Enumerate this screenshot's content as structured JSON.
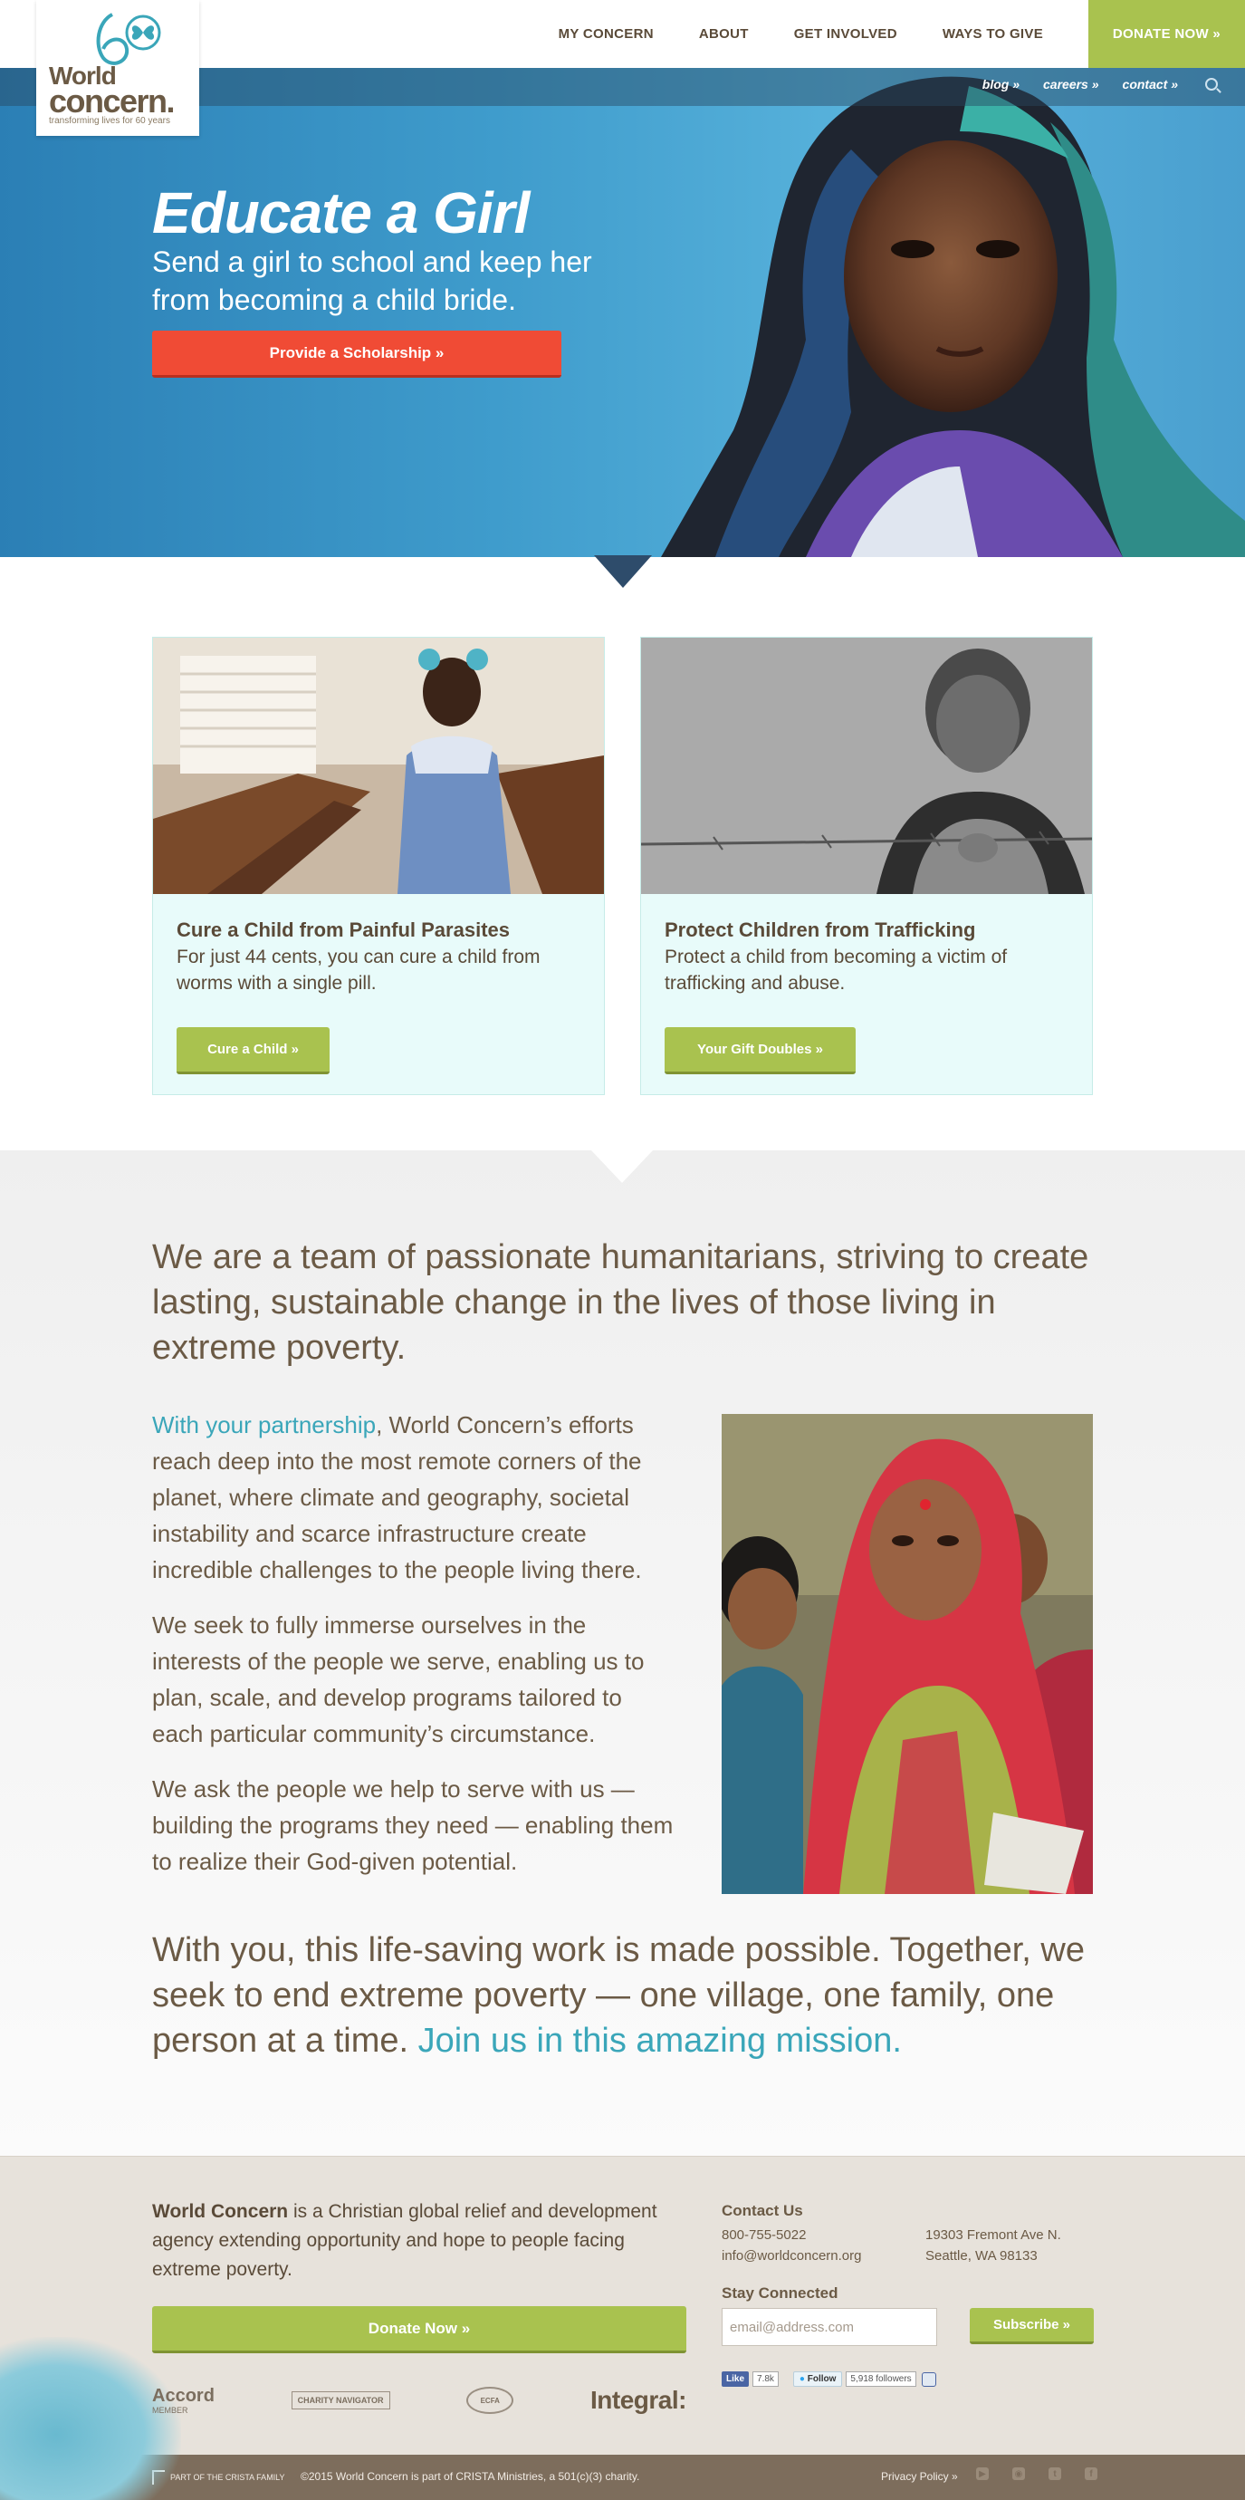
{
  "logo": {
    "line1": "World",
    "line2": "concern.",
    "tagline": "transforming lives for 60 years"
  },
  "nav": {
    "items": [
      "MY CONCERN",
      "ABOUT",
      "GET INVOLVED",
      "WAYS TO GIVE"
    ],
    "donate": "DONATE NOW »"
  },
  "subnav": {
    "items": [
      "blog »",
      "careers »",
      "contact »"
    ]
  },
  "hero": {
    "title": "Educate a Girl",
    "subtitle": "Send a girl to school and keep her from becoming a child bride.",
    "cta": "Provide a Scholarship »"
  },
  "cards": [
    {
      "title": "Cure a Child from Painful Parasites",
      "text": "For just 44 cents, you can cure a child from worms with a single pill.",
      "button": "Cure a Child »"
    },
    {
      "title": "Protect Children from Trafficking",
      "text": "Protect a child from becoming a victim of trafficking and abuse.",
      "button": "Your Gift Doubles »"
    }
  ],
  "about": {
    "lead": "We are a team of passionate humanitarians, striving to create lasting, sustainable change in the lives of those living in extreme poverty.",
    "p1_link": "With your partnership",
    "p1_rest": ", World Concern’s efforts reach deep into the most remote corners of the planet, where climate and geography, societal instability and scarce infrastructure create incredible challenges to the people living there.",
    "p2": "We seek to fully immerse ourselves in the interests of the people we serve, enabling us to plan, scale, and develop programs tailored to each particular community’s circumstance.",
    "p3": "We ask the people we help to serve with us — building the programs they need — enabling them to realize their God-given potential.",
    "closing": "With you, this life-saving work is made possible. Together, we seek to end extreme poverty — one village, one family, one person at a time. ",
    "closing_link": "Join us in this amazing mission."
  },
  "footer": {
    "org_name": "World Concern",
    "org_desc": " is a Christian global relief and development agency extending opportunity and hope to people facing extreme poverty.",
    "donate": "Donate Now »",
    "badges": {
      "accord": "Accord",
      "accord_sub": "MEMBER",
      "charity": "CHARITY NAVIGATOR",
      "ecfa": "ECFA",
      "integral": "Integral:"
    },
    "contact_heading": "Contact Us",
    "phone": "800-755-5022",
    "email_link": "info@worldconcern.org",
    "address1": "19303 Fremont Ave N.",
    "address2": "Seattle, WA 98133",
    "stay_heading": "Stay Connected",
    "email_placeholder": "email@address.com",
    "subscribe": "Subscribe »",
    "fb_like": "Like",
    "fb_count": "7.8k",
    "tw_follow": "Follow",
    "tw_count": "5,918 followers"
  },
  "bottombar": {
    "crista": "PART OF THE CRISTA FAMILY",
    "copyright": "©2015 World Concern is part of CRISTA Ministries, a 501(c)(3) charity.",
    "privacy": "Privacy Policy »",
    "social_icons": [
      "youtube-icon",
      "instagram-icon",
      "twitter-icon",
      "facebook-icon"
    ]
  },
  "colors": {
    "green": "#a9c24f",
    "red": "#f04b35",
    "teal": "#3aa6b9",
    "brown": "#6b5a45"
  }
}
